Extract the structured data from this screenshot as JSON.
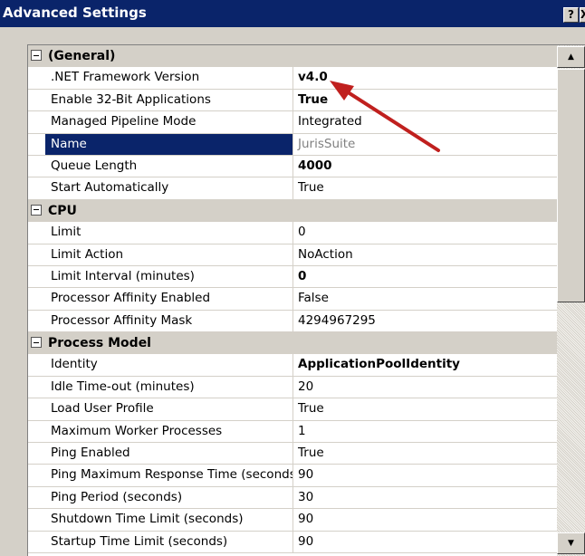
{
  "window": {
    "title": "Advanced Settings",
    "help_label": "?",
    "close_label": "X"
  },
  "grid": {
    "sections": [
      {
        "name": "(General)",
        "rows": [
          {
            "name": ".NET Framework Version",
            "value": "v4.0",
            "bold": true
          },
          {
            "name": "Enable 32-Bit Applications",
            "value": "True",
            "bold": true
          },
          {
            "name": "Managed Pipeline Mode",
            "value": "Integrated",
            "bold": false
          },
          {
            "name": "Name",
            "value": "JurisSuite",
            "bold": false,
            "selected": true,
            "disabled": true
          },
          {
            "name": "Queue Length",
            "value": "4000",
            "bold": true
          },
          {
            "name": "Start Automatically",
            "value": "True",
            "bold": false
          }
        ]
      },
      {
        "name": "CPU",
        "rows": [
          {
            "name": "Limit",
            "value": "0",
            "bold": false
          },
          {
            "name": "Limit Action",
            "value": "NoAction",
            "bold": false
          },
          {
            "name": "Limit Interval (minutes)",
            "value": "0",
            "bold": true
          },
          {
            "name": "Processor Affinity Enabled",
            "value": "False",
            "bold": false
          },
          {
            "name": "Processor Affinity Mask",
            "value": "4294967295",
            "bold": false
          }
        ]
      },
      {
        "name": "Process Model",
        "rows": [
          {
            "name": "Identity",
            "value": "ApplicationPoolIdentity",
            "bold": true
          },
          {
            "name": "Idle Time-out (minutes)",
            "value": "20",
            "bold": false
          },
          {
            "name": "Load User Profile",
            "value": "True",
            "bold": false
          },
          {
            "name": "Maximum Worker Processes",
            "value": "1",
            "bold": false
          },
          {
            "name": "Ping Enabled",
            "value": "True",
            "bold": false
          },
          {
            "name": "Ping Maximum Response Time (seconds)",
            "value": "90",
            "bold": false
          },
          {
            "name": "Ping Period (seconds)",
            "value": "30",
            "bold": false
          },
          {
            "name": "Shutdown Time Limit (seconds)",
            "value": "90",
            "bold": false
          },
          {
            "name": "Startup Time Limit (seconds)",
            "value": "90",
            "bold": false
          }
        ]
      }
    ]
  },
  "scrollbar": {
    "up_icon": "scroll-up-arrow-icon",
    "down_icon": "scroll-down-arrow-icon",
    "position": 0
  },
  "annotation": {
    "color": "#c0201e",
    "icon": "red-arrow-pointing-to-version"
  },
  "colors": {
    "title_bar": "#0a246a",
    "selection": "#0a246a",
    "category_bg": "#d4d0c8"
  }
}
